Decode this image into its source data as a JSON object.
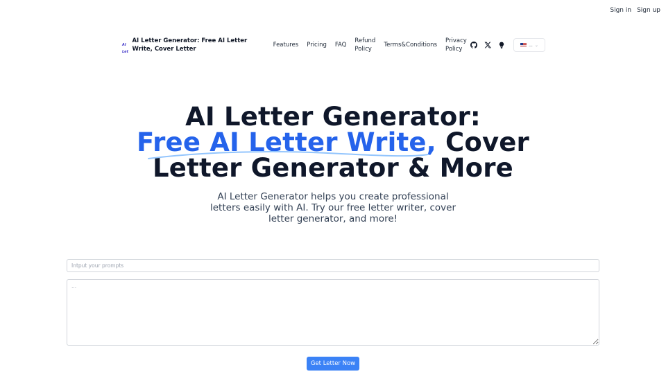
{
  "auth": {
    "signin": "Sign in",
    "signup": "Sign up"
  },
  "nav": {
    "logo_text": "AI Letter",
    "brand_title": "AI Letter Generator: Free AI Letter Write, Cover Letter",
    "features": "Features",
    "pricing": "Pricing",
    "faq": "FAQ",
    "refund": "Refund Policy",
    "terms": "Terms&Conditions",
    "privacy": "Privacy Policy",
    "icons": [
      "github-icon",
      "x-icon",
      "lightbulb-icon"
    ],
    "language": "🇺🇸..."
  },
  "hero": {
    "line1": "AI Letter Generator:",
    "line2_highlight": "Free AI Letter Write,",
    "line2_rest": " Cover",
    "line3": "Letter Generator & More",
    "subtitle": "AI Letter Generator helps you create professional letters easily with AI. Try our free letter writer, cover letter generator, and more!",
    "highlight_color": "#2563eb"
  },
  "form": {
    "prompt_placeholder": "Intput your prompts",
    "output_placeholder": "...",
    "button_label": "Get Letter Now",
    "button_color": "#3b82f6"
  }
}
